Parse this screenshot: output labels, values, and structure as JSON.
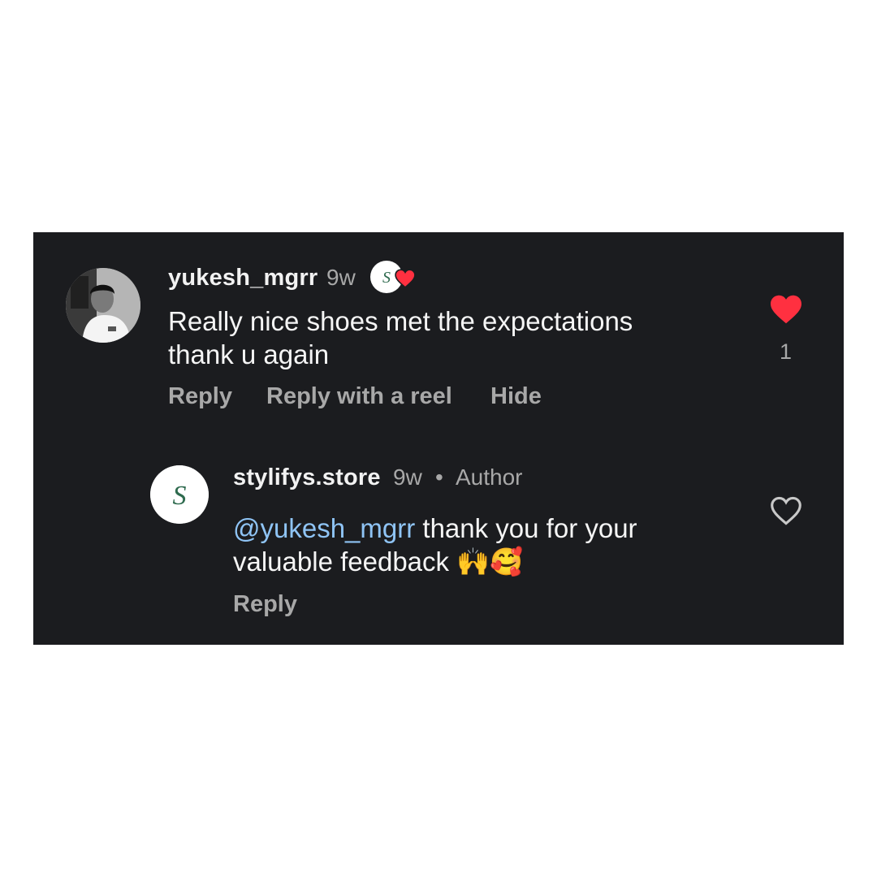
{
  "comment": {
    "username": "yukesh_mgrr",
    "time": "9w",
    "text_line1": "Really nice shoes met the expectations",
    "text_line2": "thank u again",
    "like_count": "1",
    "liked": true,
    "liked_by_author_icon": "heart-badge-icon",
    "actions": {
      "reply": "Reply",
      "reply_with_reel": "Reply with a reel",
      "hide": "Hide"
    }
  },
  "reply": {
    "username": "stylifys.store",
    "time": "9w",
    "separator": "•",
    "author_label": "Author",
    "mention": "@yukesh_mgrr",
    "text_line1": " thank you for your",
    "text_line2": "valuable feedback",
    "emojis": "🙌🥰",
    "liked": false,
    "actions": {
      "reply": "Reply"
    }
  },
  "colors": {
    "panel_bg": "#1b1c1f",
    "like_red": "#ff3040",
    "mention_blue": "#8fc4f5",
    "muted_gray": "#a8a8a8"
  }
}
